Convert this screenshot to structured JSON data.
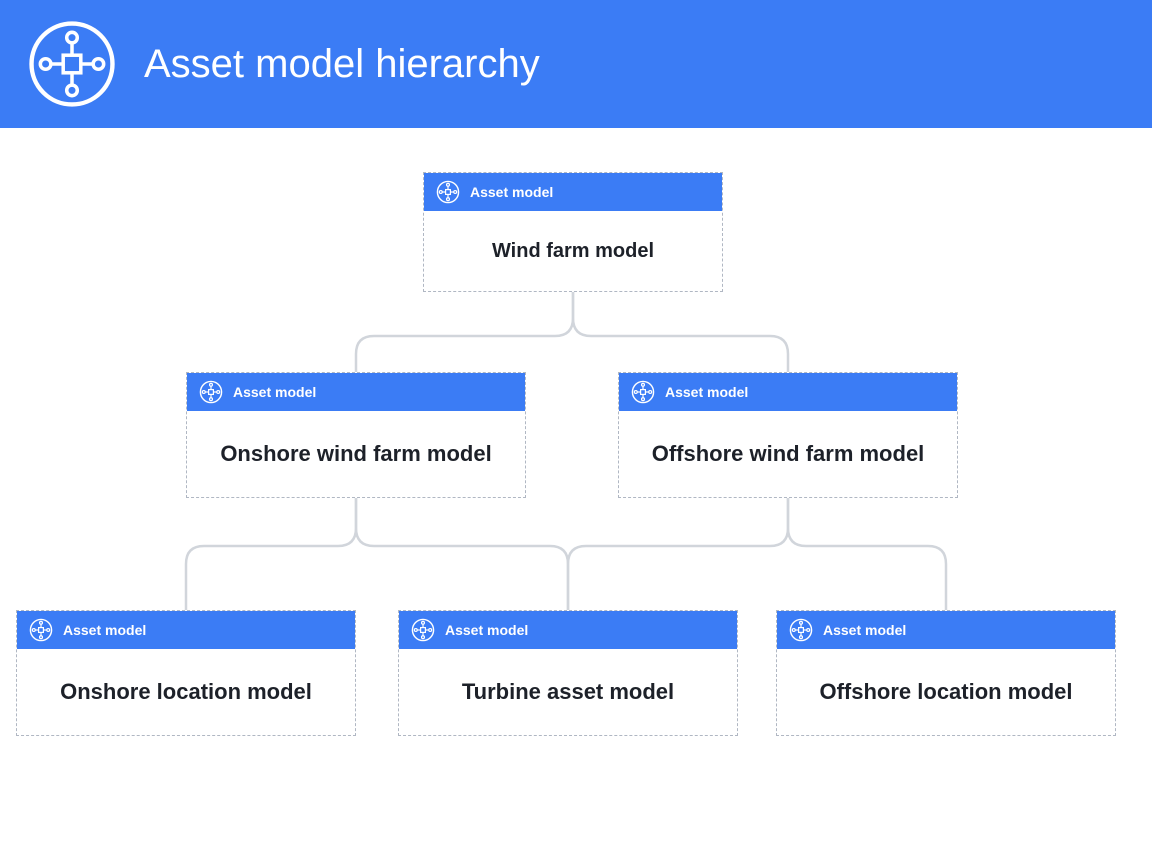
{
  "header": {
    "title": "Asset model hierarchy"
  },
  "colors": {
    "primary": "#3b7cf5",
    "connector": "#d1d5db",
    "text": "#1d2129"
  },
  "node_type_label": "Asset model",
  "nodes": {
    "root": {
      "type_label": "Asset model",
      "name": "Wind farm model",
      "children": [
        "onshore_farm",
        "offshore_farm"
      ]
    },
    "onshore_farm": {
      "type_label": "Asset model",
      "name": "Onshore wind farm model",
      "children": [
        "onshore_location",
        "turbine"
      ]
    },
    "offshore_farm": {
      "type_label": "Asset model",
      "name": "Offshore wind farm model",
      "children": [
        "turbine",
        "offshore_location"
      ]
    },
    "onshore_location": {
      "type_label": "Asset model",
      "name": "Onshore location model",
      "children": []
    },
    "turbine": {
      "type_label": "Asset model",
      "name": "Turbine asset model",
      "children": []
    },
    "offshore_location": {
      "type_label": "Asset model",
      "name": "Offshore location model",
      "children": []
    }
  }
}
